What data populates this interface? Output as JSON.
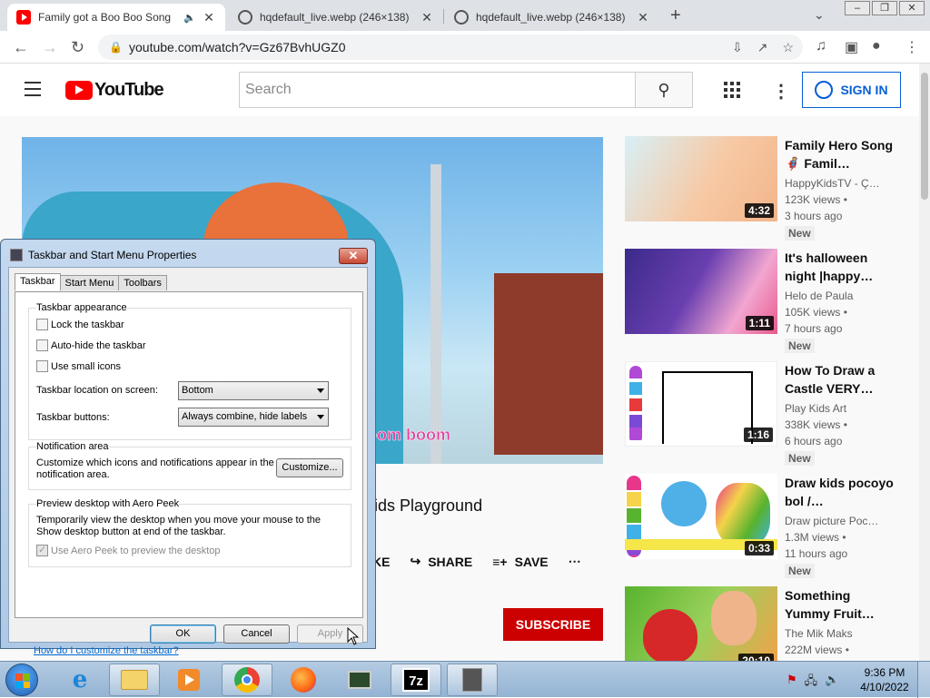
{
  "browser": {
    "tabs": [
      {
        "title": "Family got a Boo Boo Song",
        "audio": true
      },
      {
        "title": "hqdefault_live.webp (246×138)"
      },
      {
        "title": "hqdefault_live.webp (246×138)"
      }
    ],
    "url": "youtube.com/watch?v=Gz67BvhUGZ0"
  },
  "youtube": {
    "logo_text": "YouTube",
    "search_placeholder": "Search",
    "sign_in": "SIGN IN",
    "video_caption": "oom boom",
    "video_title": "ids Playground",
    "actions": {
      "like_partial": "KE",
      "share": "SHARE",
      "save": "SAVE"
    },
    "subscribe": "SUBSCRIBE",
    "recommendations": [
      {
        "title": "Family Hero Song🦸 Famil…",
        "channel": "HappyKidsTV - Ç…",
        "views": "123K views •",
        "ago": "3 hours ago",
        "badge": "New",
        "duration": "4:32",
        "colors": [
          "#f7c9a4",
          "#d8f0f7"
        ]
      },
      {
        "title": "It's halloween night |happy…",
        "channel": "Helo de Paula",
        "views": "105K views •",
        "ago": "7 hours ago",
        "badge": "New",
        "duration": "1:11",
        "colors": [
          "#3b2a8a",
          "#f2a6d0"
        ]
      },
      {
        "title": "How To Draw a Castle VERY…",
        "channel": "Play Kids Art",
        "views": "338K views •",
        "ago": "6 hours ago",
        "badge": "New",
        "duration": "1:16",
        "colors": [
          "#ffffff",
          "#f07a3a"
        ]
      },
      {
        "title": "Draw kids pocoyo bol /…",
        "channel": "Draw picture Poc…",
        "views": "1.3M views •",
        "ago": "11 hours ago",
        "badge": "New",
        "duration": "0:33",
        "colors": [
          "#4fb0e8",
          "#f5d34a"
        ]
      },
      {
        "title": "Something Yummy Fruit…",
        "channel": "The Mik Maks",
        "views": "222M views •",
        "ago": "",
        "badge": "",
        "duration": "20:10",
        "colors": [
          "#58b32e",
          "#d62828"
        ]
      }
    ]
  },
  "dialog": {
    "title": "Taskbar and Start Menu Properties",
    "tabs": [
      "Taskbar",
      "Start Menu",
      "Toolbars"
    ],
    "appearance": {
      "title": "Taskbar appearance",
      "lock": "Lock the taskbar",
      "autohide": "Auto-hide the taskbar",
      "small_icons": "Use small icons",
      "location_label": "Taskbar location on screen:",
      "location_value": "Bottom",
      "buttons_label": "Taskbar buttons:",
      "buttons_value": "Always combine, hide labels"
    },
    "notification": {
      "title": "Notification area",
      "desc": "Customize which icons and notifications appear in the notification area.",
      "customize": "Customize..."
    },
    "peek": {
      "title": "Preview desktop with Aero Peek",
      "desc": "Temporarily view the desktop when you move your mouse to the Show desktop button at end of the taskbar.",
      "checkbox": "Use Aero Peek to preview the desktop"
    },
    "help_link": "How do I customize the taskbar?",
    "ok": "OK",
    "cancel": "Cancel",
    "apply": "Apply"
  },
  "taskbar": {
    "time": "9:36 PM",
    "date": "4/10/2022"
  }
}
